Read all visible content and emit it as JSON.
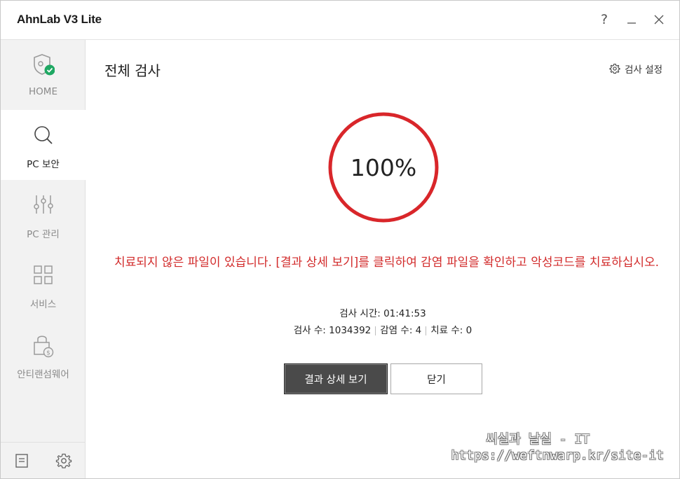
{
  "app": {
    "title": "AhnLab V3 Lite"
  },
  "titlebar": {
    "help": "?",
    "minimize": "minimize",
    "close": "close"
  },
  "sidebar": {
    "items": [
      {
        "label": "HOME",
        "icon": "shield-check-icon"
      },
      {
        "label": "PC 보안",
        "icon": "search-icon"
      },
      {
        "label": "PC 관리",
        "icon": "sliders-icon"
      },
      {
        "label": "서비스",
        "icon": "grid-icon"
      },
      {
        "label": "안티랜섬웨어",
        "icon": "lock-dollar-icon"
      }
    ],
    "bottom": [
      {
        "icon": "notes-icon"
      },
      {
        "icon": "gear-icon"
      }
    ]
  },
  "main": {
    "title": "전체 검사",
    "settings_label": "검사 설정",
    "progress": {
      "percent": 100,
      "text": "100%",
      "color": "#d9262a"
    },
    "warning": "치료되지 않은 파일이 있습니다. [결과 상세 보기]를 클릭하여 감염 파일을 확인하고 악성코드를 치료하십시오.",
    "stats": {
      "time": "검사 시간: 01:41:53",
      "scanned": "검사 수: 1034392",
      "infected": "감염 수: 4",
      "treated": "치료 수: 0"
    },
    "buttons": {
      "details": "결과 상세 보기",
      "close": "닫기"
    },
    "watermark": {
      "line1": "씨실과 날실 - IT",
      "line2": "https://weftnwarp.kr/site-it"
    }
  },
  "colors": {
    "accent_red": "#d9262a",
    "check_green": "#1fa863",
    "sidebar_bg": "#f2f2f2"
  }
}
